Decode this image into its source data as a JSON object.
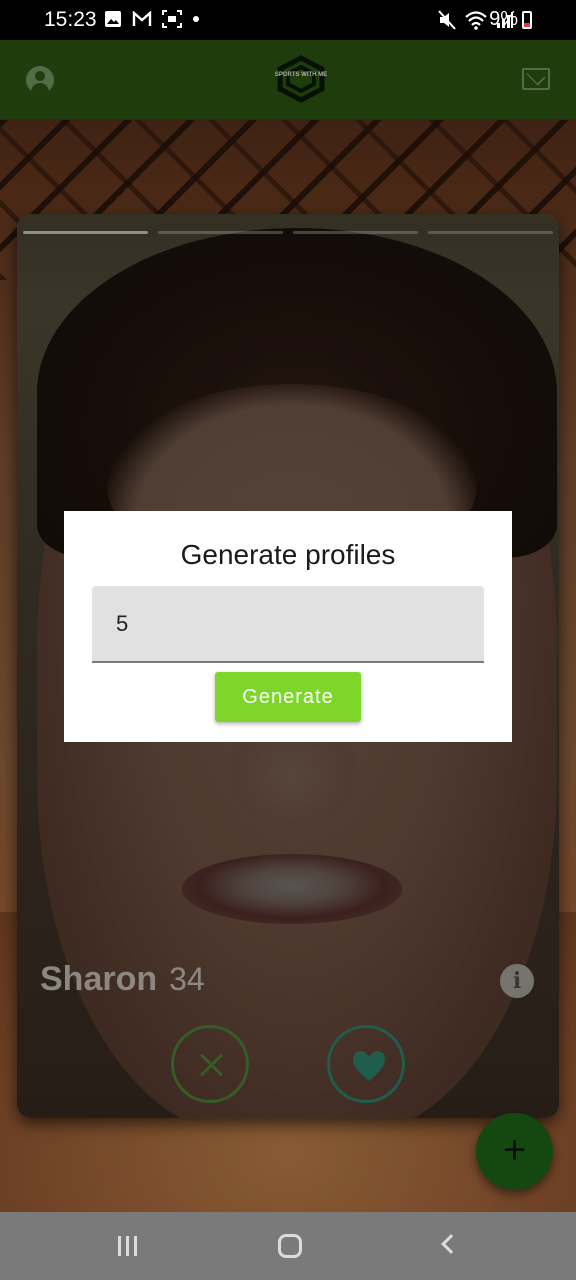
{
  "status_bar": {
    "time": "15:23",
    "battery": "9%",
    "left_icons": [
      "image-icon",
      "gmail-icon",
      "screenshot-icon",
      "dot-icon"
    ],
    "right_icons": [
      "mute-icon",
      "wifi-icon",
      "signal-icon",
      "battery-icon"
    ]
  },
  "app_bar": {
    "logo_text": "SPORTS WITH ME",
    "left_icon": "account-icon",
    "right_icon": "mail-icon",
    "color": "#2e5a12"
  },
  "profile_card": {
    "name": "Sharon",
    "age": "34",
    "photo_count": 4,
    "active_photo": 1,
    "info_icon": "info-icon",
    "dislike_icon": "close-icon",
    "like_icon": "heart-icon"
  },
  "fab": {
    "label": "+",
    "icon": "plus-icon",
    "color": "#1f6a1a"
  },
  "dialog": {
    "title": "Generate profiles",
    "input_value": "5",
    "button_label": "Generate",
    "button_color": "#7ed62a"
  },
  "nav_bar": {
    "items": [
      "recents-icon",
      "home-icon",
      "back-icon"
    ]
  }
}
